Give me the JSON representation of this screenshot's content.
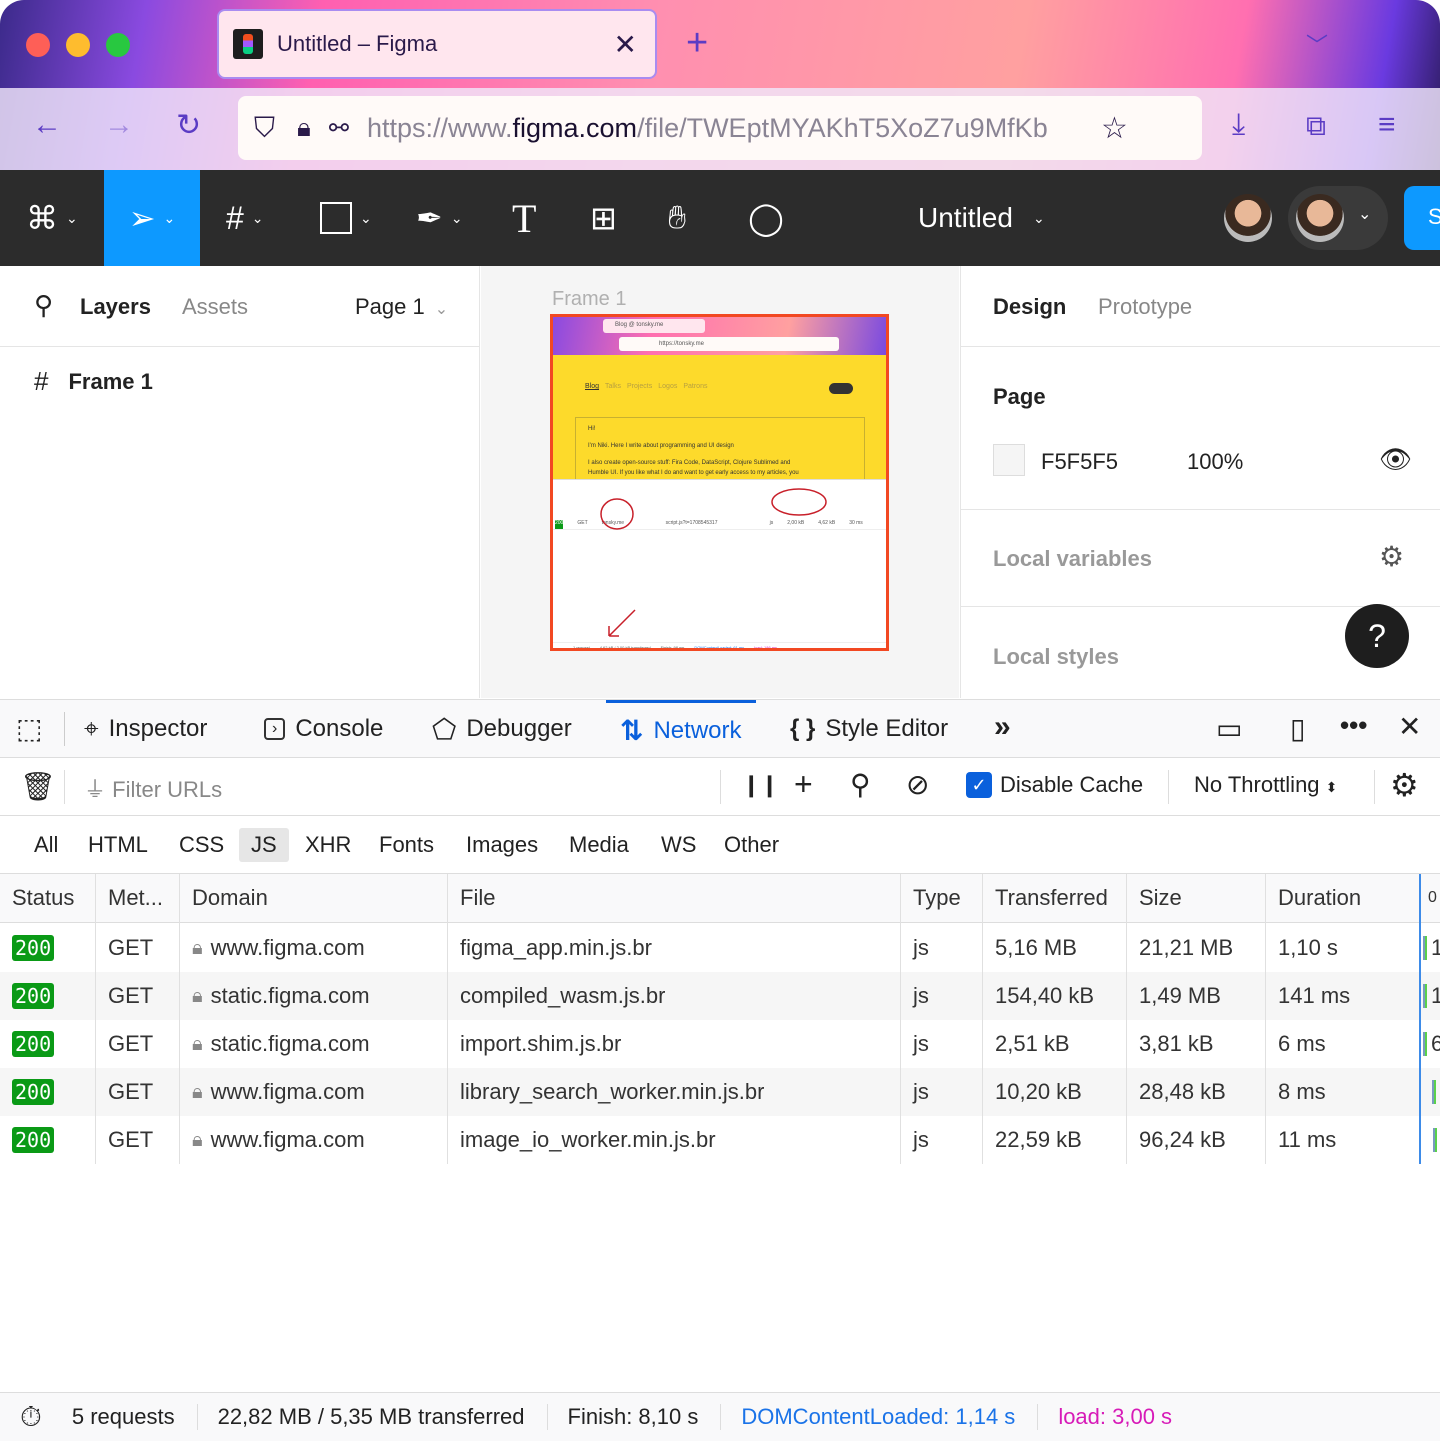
{
  "browser": {
    "tab_title": "Untitled – Figma",
    "url_prefix": "https://www.",
    "url_domain": "figma.com",
    "url_path": "/file/TWEptMYAKhT5XoZ7u9MfKb",
    "icons": [
      "back-icon",
      "forward-icon",
      "reload-icon",
      "shield-icon",
      "lock-icon",
      "permissions-icon",
      "star-icon",
      "download-icon",
      "extensions-icon",
      "menu-icon"
    ]
  },
  "figma": {
    "file_title": "Untitled",
    "share_label": "S",
    "left_tabs": {
      "layers": "Layers",
      "assets": "Assets",
      "page": "Page 1"
    },
    "layers": [
      {
        "name": "Frame 1"
      }
    ],
    "frame_label": "Frame 1",
    "right_tabs": {
      "design": "Design",
      "prototype": "Prototype"
    },
    "page_section": {
      "title": "Page",
      "color": "F5F5F5",
      "opacity": "100%"
    },
    "local_variables": "Local variables",
    "local_styles": "Local styles",
    "help": "?",
    "thumbnail": {
      "tab": "Blog @ tonsky.me",
      "url": "https://tonsky.me",
      "nav": [
        "Blog",
        "Talks",
        "Projects",
        "Logos",
        "Patrons"
      ],
      "lines": [
        "Hi!",
        "I'm Niki. Here I write about programming and UI design",
        "I also create open-source stuff: Fira Code, DataScript, Clojure Sublimed and",
        "Humble UI. If you like what I do and want to get early access to my articles, you"
      ],
      "row": [
        "200",
        "GET",
        "tonsky.me",
        "script.js?t=1708545317",
        "js",
        "2,00 kB",
        "4,62 kB",
        "30 ms"
      ],
      "status": [
        "1 request",
        "4,62 kB / 2,00 kB transferred",
        "Finish: 98 ms",
        "DOMContentLoaded: 61 ms",
        "load: 186 ms"
      ]
    }
  },
  "devtools": {
    "tabs": [
      {
        "label": "Inspector"
      },
      {
        "label": "Console"
      },
      {
        "label": "Debugger"
      },
      {
        "label": "Network",
        "active": true
      },
      {
        "label": "Style Editor"
      }
    ],
    "filter_placeholder": "Filter URLs",
    "disable_cache": {
      "label": "Disable Cache",
      "checked": true
    },
    "throttling": "No Throttling",
    "types": [
      "All",
      "HTML",
      "CSS",
      "JS",
      "XHR",
      "Fonts",
      "Images",
      "Media",
      "WS",
      "Other"
    ],
    "active_type": "JS",
    "columns": [
      "Status",
      "Met...",
      "Domain",
      "File",
      "Type",
      "Transferred",
      "Size",
      "Duration",
      "0"
    ],
    "rows": [
      {
        "status": "200",
        "method": "GET",
        "domain": "www.figma.com",
        "file": "figma_app.min.js.br",
        "type": "js",
        "transferred": "5,16 MB",
        "size": "21,21 MB",
        "duration": "1,10 s",
        "wf": "1"
      },
      {
        "status": "200",
        "method": "GET",
        "domain": "static.figma.com",
        "file": "compiled_wasm.js.br",
        "type": "js",
        "transferred": "154,40 kB",
        "size": "1,49 MB",
        "duration": "141 ms",
        "wf": "1"
      },
      {
        "status": "200",
        "method": "GET",
        "domain": "static.figma.com",
        "file": "import.shim.js.br",
        "type": "js",
        "transferred": "2,51 kB",
        "size": "3,81 kB",
        "duration": "6 ms",
        "wf": "6"
      },
      {
        "status": "200",
        "method": "GET",
        "domain": "www.figma.com",
        "file": "library_search_worker.min.js.br",
        "type": "js",
        "transferred": "10,20 kB",
        "size": "28,48 kB",
        "duration": "8 ms",
        "wf": ""
      },
      {
        "status": "200",
        "method": "GET",
        "domain": "www.figma.com",
        "file": "image_io_worker.min.js.br",
        "type": "js",
        "transferred": "22,59 kB",
        "size": "96,24 kB",
        "duration": "11 ms",
        "wf": ""
      }
    ],
    "summary": {
      "requests": "5 requests",
      "transferred": "22,82 MB / 5,35 MB transferred",
      "finish": "Finish: 8,10 s",
      "dcl": "DOMContentLoaded: 1,14 s",
      "load": "load: 3,00 s"
    },
    "colors": {
      "accent": "#0a60dc",
      "status_ok": "#0a9a16",
      "dcl": "#1a73e8",
      "load": "#d71bb8"
    }
  }
}
